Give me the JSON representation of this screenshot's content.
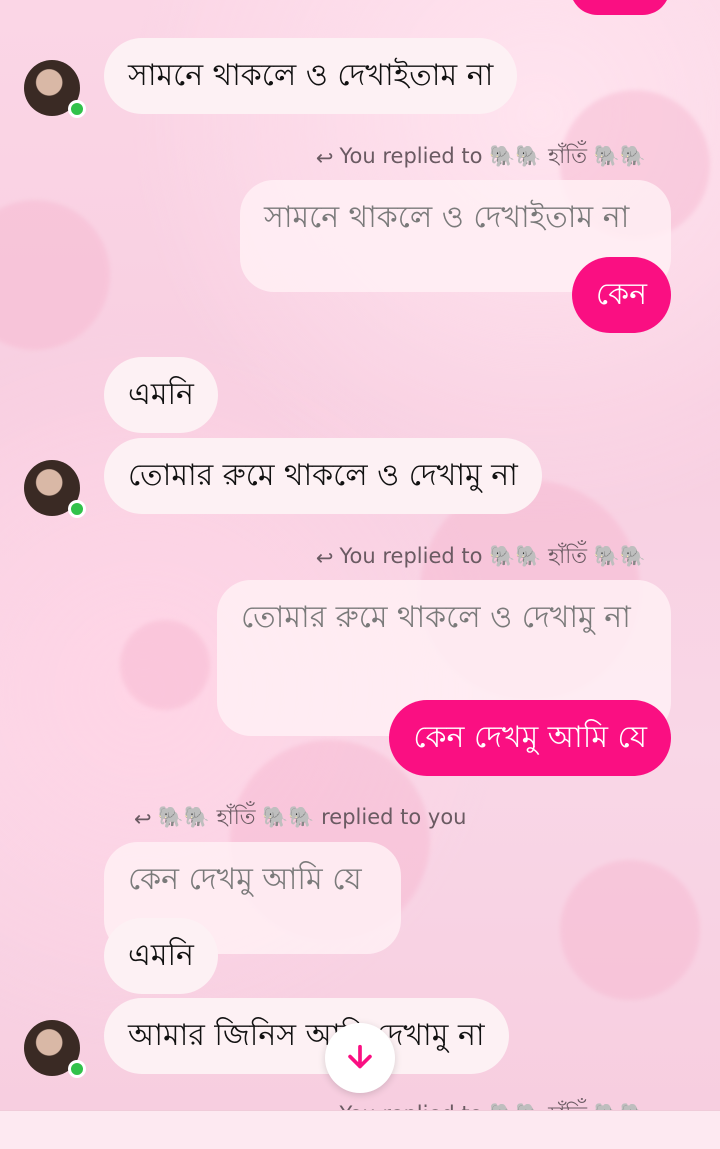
{
  "messages": {
    "m1": "সামনে থাকলে ও দেখাইতাম না",
    "r1_label": "You replied to 🐘🐘 হাঁতিঁ 🐘🐘",
    "r1_quote": "সামনে থাকলে ও দেখাইতাম না",
    "r1_text": "কেন",
    "m2": "এমনি",
    "m3": "তোমার রুমে থাকলে ও দেখামু না",
    "r2_label": "You replied to 🐘🐘 হাঁতিঁ 🐘🐘",
    "r2_quote": "তোমার রুমে থাকলে ও দেখামু না",
    "r2_text": "কেন দেখমু আমি যে",
    "r3_label": "🐘🐘 হাঁতিঁ 🐘🐘 replied to you",
    "r3_quote": "কেন দেখমু আমি যে",
    "m4": "এমনি",
    "m5": "আমার জিনিস আমি দেখামু না",
    "r4_label": "You replied to 🐘🐘 হাঁতিঁ 🐘🐘"
  },
  "colors": {
    "accent": "#fa0f82",
    "online": "#31c24a"
  }
}
